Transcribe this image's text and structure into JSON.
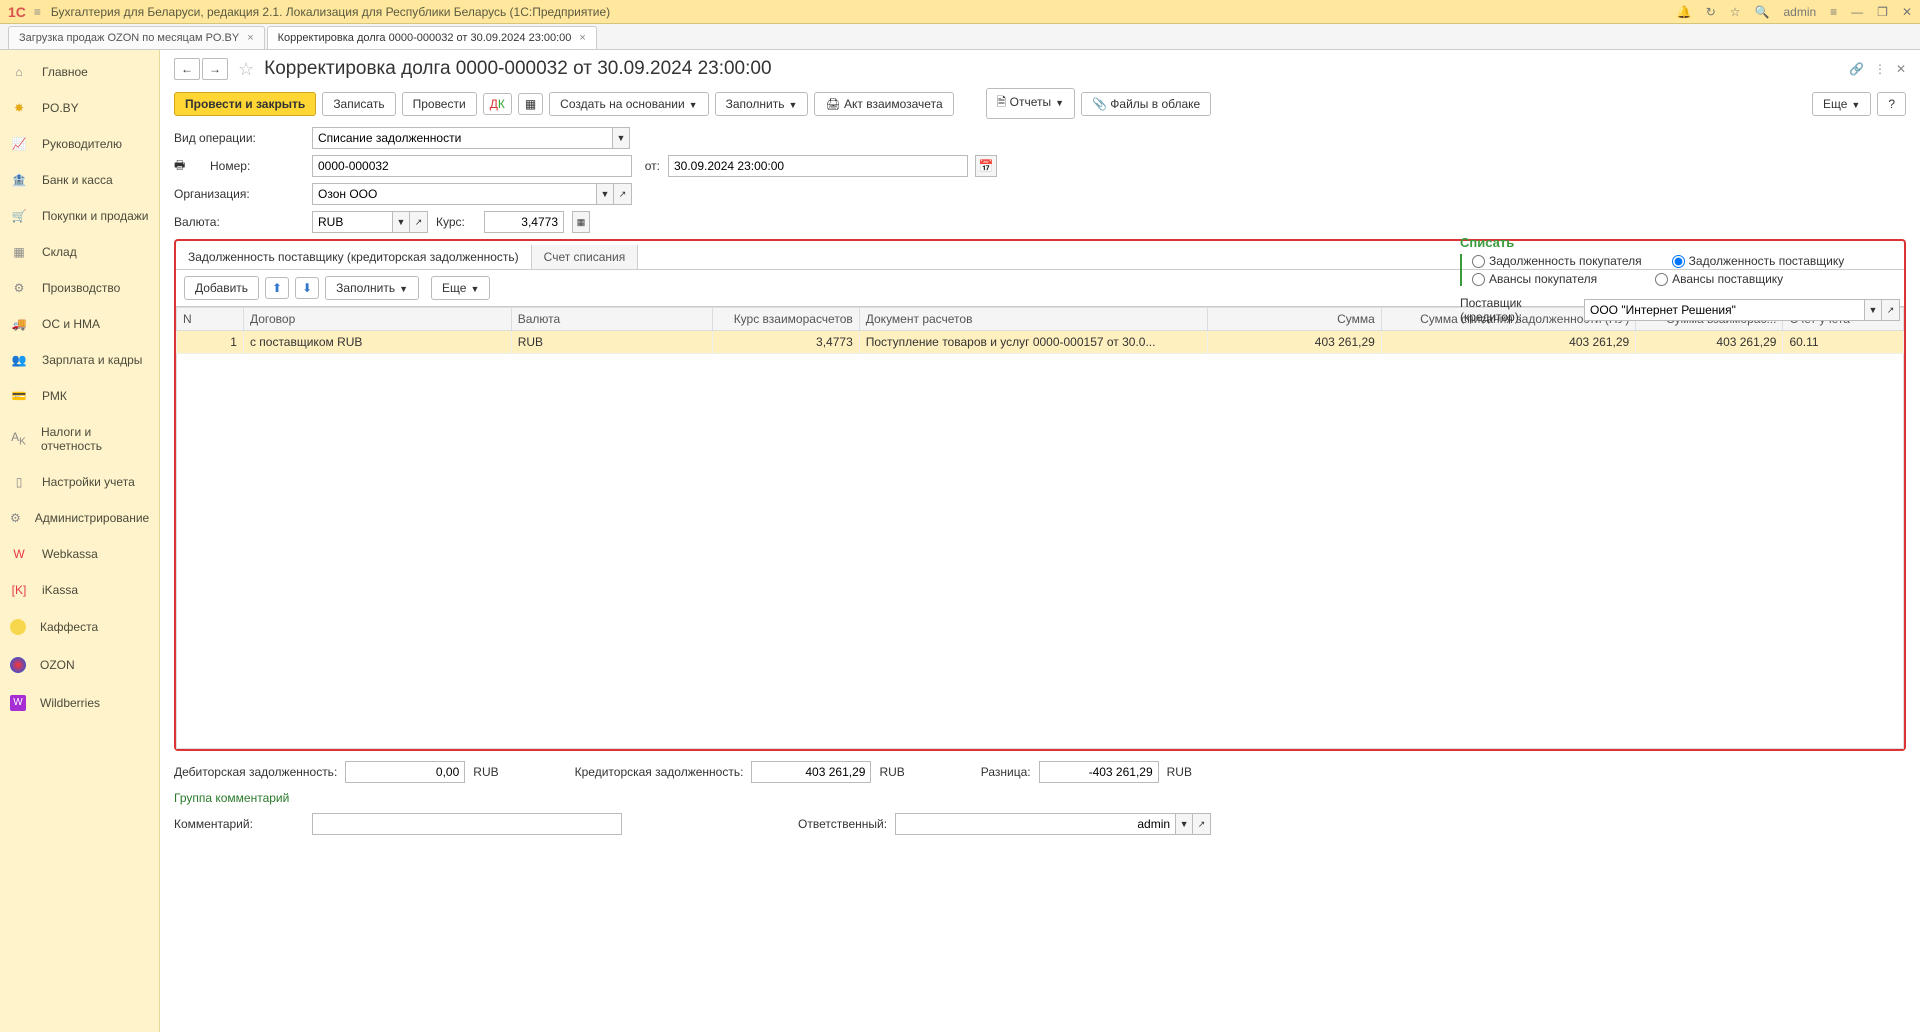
{
  "titlebar": {
    "app_title": "Бухгалтерия для Беларуси, редакция 2.1. Локализация для Республики Беларусь   (1С:Предприятие)",
    "user": "admin"
  },
  "tabs": [
    {
      "label": "Загрузка продаж OZON по месяцам PO.BY"
    },
    {
      "label": "Корректировка долга 0000-000032 от 30.09.2024 23:00:00"
    }
  ],
  "sidebar": {
    "items": [
      {
        "label": "Главное"
      },
      {
        "label": "PO.BY"
      },
      {
        "label": "Руководителю"
      },
      {
        "label": "Банк и касса"
      },
      {
        "label": "Покупки и продажи"
      },
      {
        "label": "Склад"
      },
      {
        "label": "Производство"
      },
      {
        "label": "ОС и НМА"
      },
      {
        "label": "Зарплата и кадры"
      },
      {
        "label": "РМК"
      },
      {
        "label": "Налоги и отчетность"
      },
      {
        "label": "Настройки учета"
      },
      {
        "label": "Администрирование"
      },
      {
        "label": "Webkassa"
      },
      {
        "label": "iKassa"
      },
      {
        "label": "Каффеста"
      },
      {
        "label": "OZON"
      },
      {
        "label": "Wildberries"
      }
    ]
  },
  "page": {
    "title": "Корректировка долга 0000-000032 от 30.09.2024 23:00:00"
  },
  "toolbar": {
    "post_close": "Провести и закрыть",
    "save": "Записать",
    "post": "Провести",
    "create_on": "Создать на основании",
    "fill": "Заполнить",
    "act": "Акт взаимозачета",
    "reports": "Отчеты",
    "files": "Файлы в облаке",
    "more": "Еще",
    "help": "?"
  },
  "form": {
    "oper_type_label": "Вид операции:",
    "oper_type_value": "Списание задолженности",
    "number_label": "Номер:",
    "number_value": "0000-000032",
    "date_label": "от:",
    "date_value": "30.09.2024 23:00:00",
    "org_label": "Организация:",
    "org_value": "Озон ООО",
    "currency_label": "Валюта:",
    "currency_value": "RUB",
    "rate_label": "Курс:",
    "rate_value": "3,4773"
  },
  "spisat": {
    "title": "Списать",
    "opt1": "Задолженность покупателя",
    "opt2": "Задолженность поставщику",
    "opt3": "Авансы покупателя",
    "opt4": "Авансы поставщику",
    "creditor_label": "Поставщик (кредитор):",
    "creditor_value": "ООО \"Интернет Решения\""
  },
  "inner_tabs": {
    "tab1": "Задолженность поставщику (кредиторская задолженность)",
    "tab2": "Счет списания"
  },
  "sub_toolbar": {
    "add": "Добавить",
    "fill": "Заполнить",
    "more": "Еще"
  },
  "table": {
    "headers": {
      "n": "N",
      "contract": "Договор",
      "currency": "Валюта",
      "rate": "Курс взаиморасчетов",
      "doc": "Документ расчетов",
      "sum": "Сумма",
      "sum_nu": "Сумма списания задолженности (НУ)",
      "sum_mutual": "Сумма взаиморас...",
      "account": "Счет учета"
    },
    "rows": [
      {
        "n": "1",
        "contract": "с поставщиком RUB",
        "currency": "RUB",
        "rate": "3,4773",
        "doc": "Поступление товаров и услуг 0000-000157 от 30.0...",
        "sum": "403 261,29",
        "sum_nu": "403 261,29",
        "sum_mutual": "403 261,29",
        "account": "60.11"
      }
    ]
  },
  "totals": {
    "debit_label": "Дебиторская задолженность:",
    "debit_value": "0,00",
    "debit_cur": "RUB",
    "credit_label": "Кредиторская задолженность:",
    "credit_value": "403 261,29",
    "credit_cur": "RUB",
    "diff_label": "Разница:",
    "diff_value": "-403 261,29",
    "diff_cur": "RUB"
  },
  "footer": {
    "group_comment": "Группа комментарий",
    "comment_label": "Комментарий:",
    "comment_value": "",
    "resp_label": "Ответственный:",
    "resp_value": "admin"
  }
}
